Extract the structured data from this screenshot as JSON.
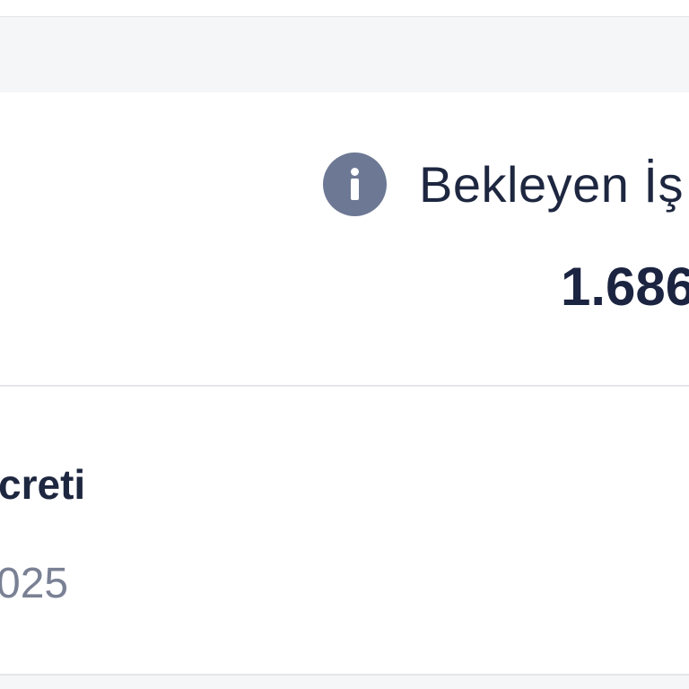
{
  "pending": {
    "icon": "info-icon",
    "label": "Bekleyen İş",
    "value": "1.686"
  },
  "row": {
    "title": "creti",
    "date": "025"
  },
  "colors": {
    "info_icon": "#6d7894",
    "text_dark": "#1e2740",
    "text_muted": "#7a8194",
    "band": "#f5f6f8",
    "divider": "#e4e6eb"
  }
}
